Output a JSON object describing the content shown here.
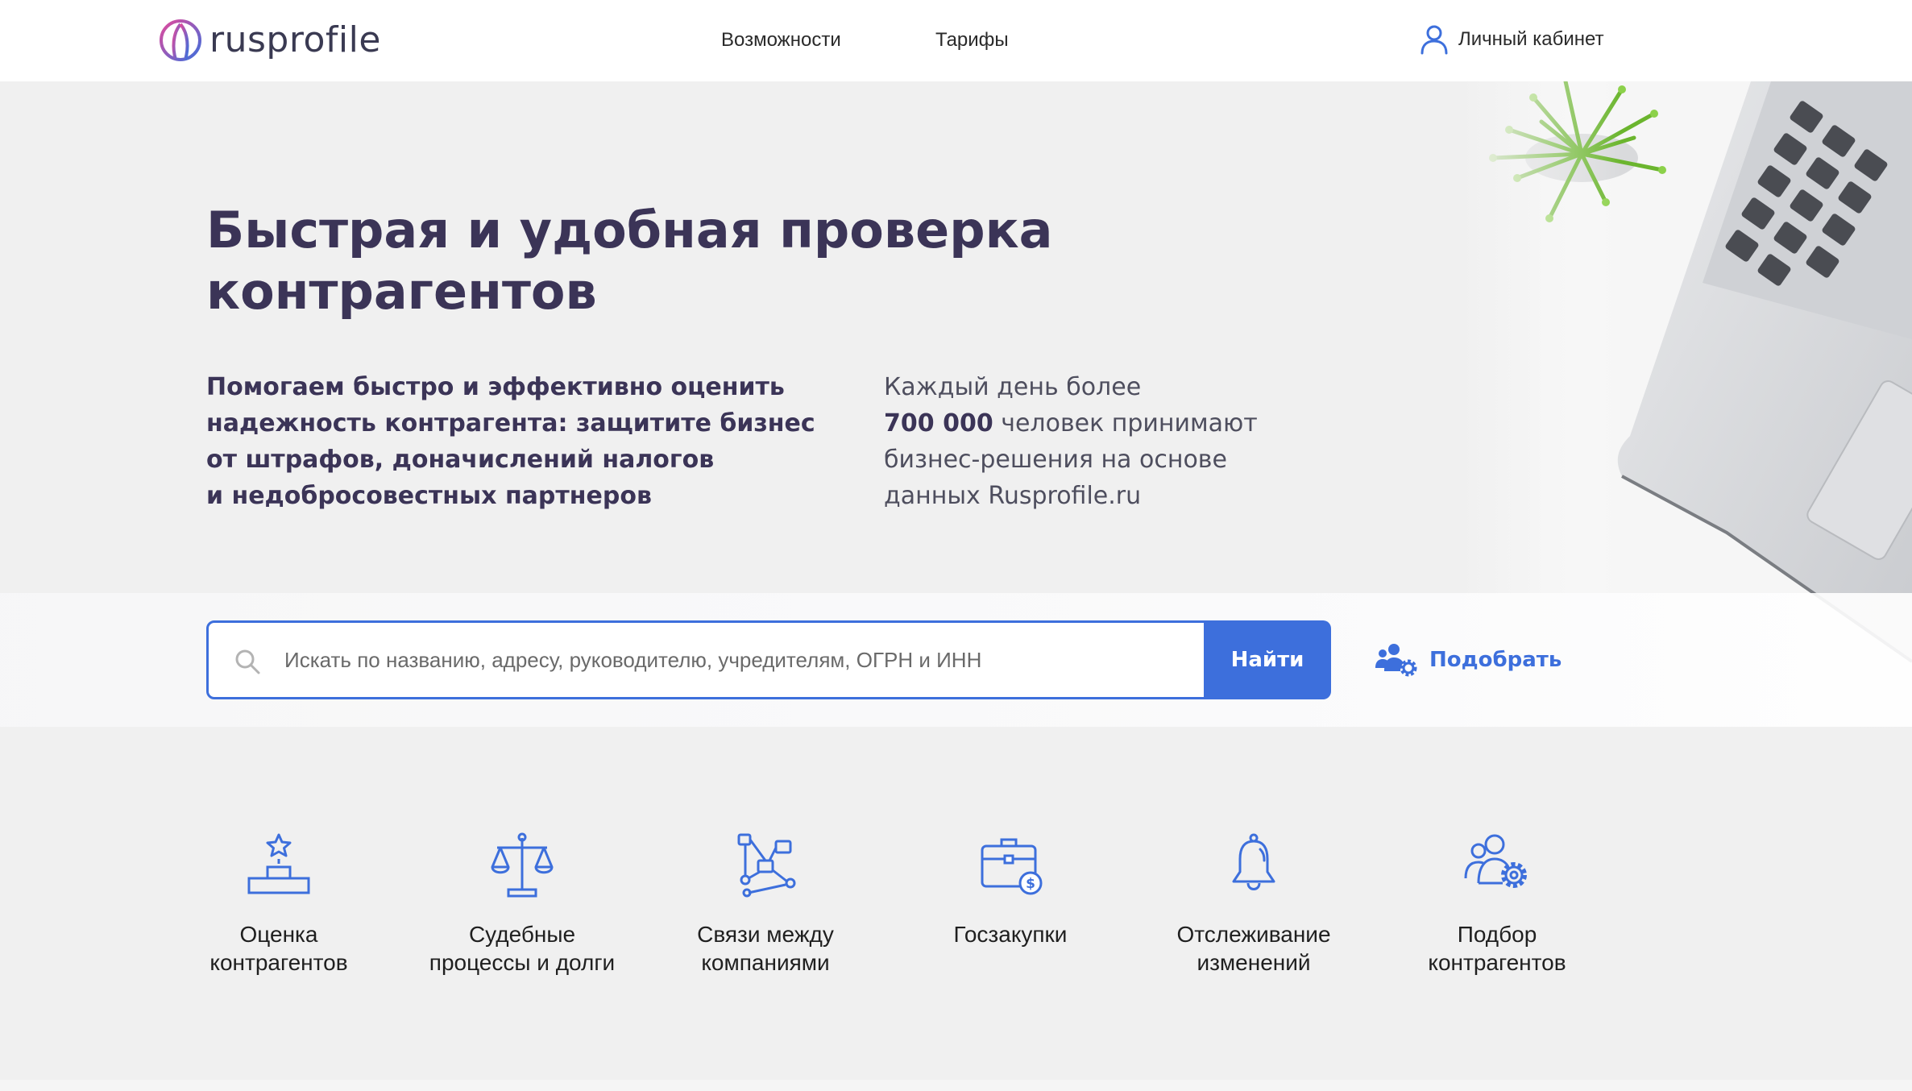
{
  "header": {
    "logo_text": "rusprofile",
    "nav": [
      {
        "label": "Возможности"
      },
      {
        "label": "Тарифы"
      }
    ],
    "cabinet_label": "Личный кабинет"
  },
  "hero": {
    "title_line1": "Быстрая и удобная проверка",
    "title_line2": "контрагентов",
    "lead_lines": [
      "Помогаем быстро и эффективно оценить",
      "надежность контрагента: защитите бизнес",
      "от штрафов, доначислений налогов",
      "и недобросовестных партнеров"
    ],
    "stat": {
      "line1": "Каждый день более",
      "number": "700 000",
      "line2_rest": " человек принимают",
      "line3": "бизнес-решения на основе",
      "line4": "данных Rusprofile.ru"
    }
  },
  "search": {
    "placeholder": "Искать по названию, адресу, руководителю, учредителям, ОГРН и ИНН",
    "value": "",
    "button_label": "Найти",
    "pick_label": "Подобрать"
  },
  "features": [
    {
      "icon": "podium-star-icon",
      "line1": "Оценка",
      "line2": "контрагентов"
    },
    {
      "icon": "scales-icon",
      "line1": "Судебные",
      "line2": "процессы и долги"
    },
    {
      "icon": "network-icon",
      "line1": "Связи между",
      "line2": "компаниями"
    },
    {
      "icon": "briefcase-dollar-icon",
      "line1": "Госзакупки",
      "line2": ""
    },
    {
      "icon": "bell-icon",
      "line1": "Отслеживание",
      "line2": "изменений"
    },
    {
      "icon": "people-gear-icon",
      "line1": "Подбор",
      "line2": "контрагентов"
    }
  ],
  "colors": {
    "accent": "#3d6fdc",
    "title": "#3b3457",
    "background": "#f0f0f0"
  }
}
